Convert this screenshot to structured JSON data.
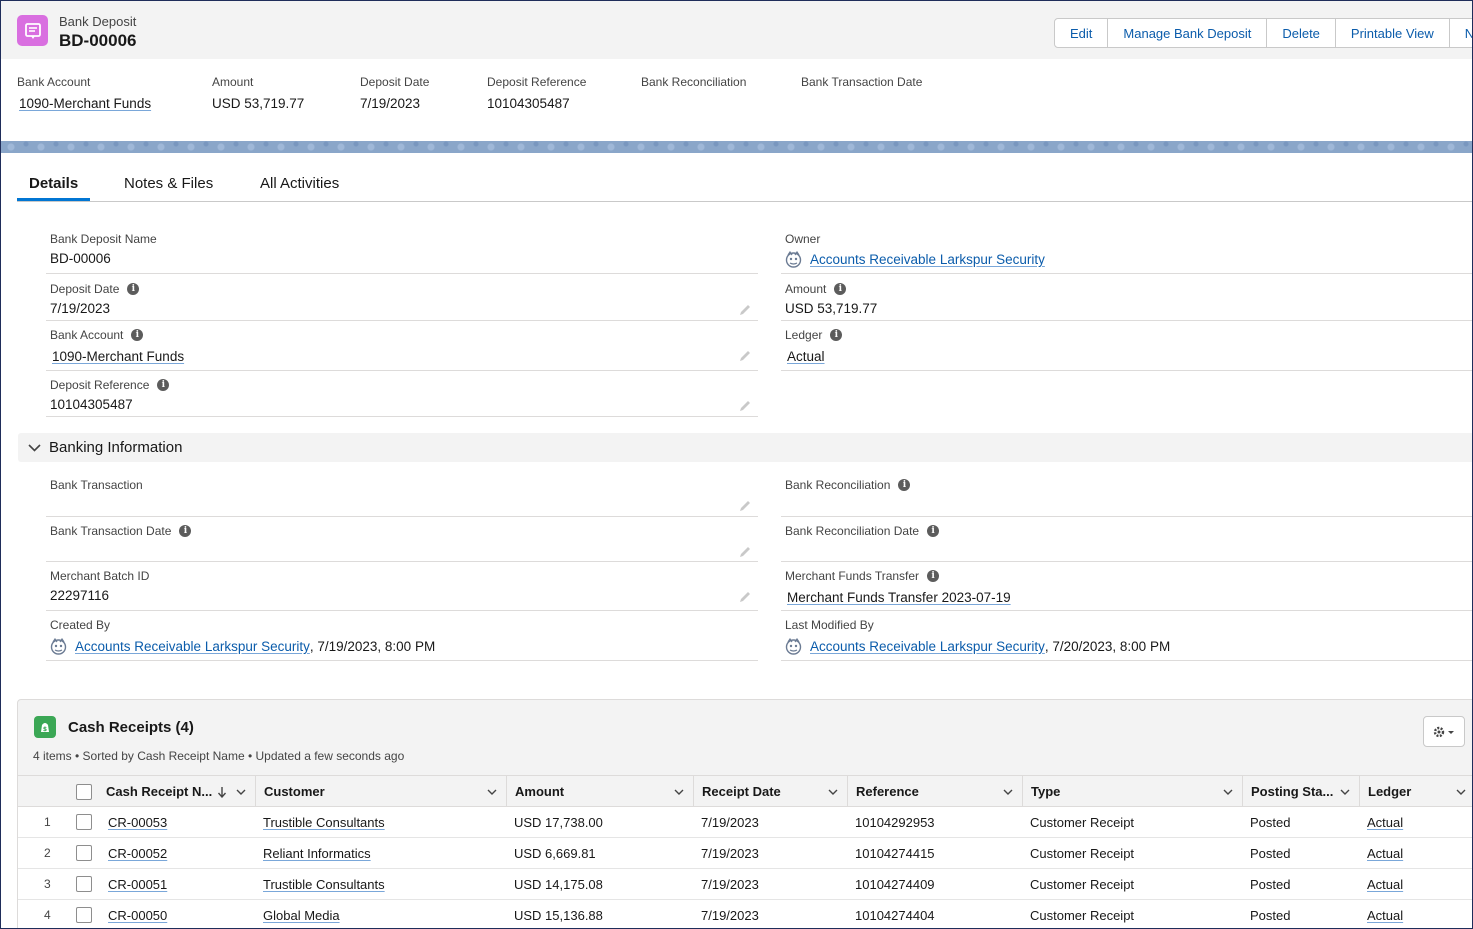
{
  "header": {
    "object_type": "Bank Deposit",
    "record_name": "BD-00006",
    "actions": [
      "Edit",
      "Manage Bank Deposit",
      "Delete",
      "Printable View",
      "New"
    ],
    "highlights": [
      {
        "label": "Bank Account",
        "value": "1090-Merchant Funds",
        "link": true
      },
      {
        "label": "Amount",
        "value": "USD 53,719.77",
        "link": false
      },
      {
        "label": "Deposit Date",
        "value": "7/19/2023",
        "link": false
      },
      {
        "label": "Deposit Reference",
        "value": "10104305487",
        "link": false
      },
      {
        "label": "Bank Reconciliation",
        "value": "",
        "link": false
      },
      {
        "label": "Bank Transaction Date",
        "value": "",
        "link": false
      }
    ]
  },
  "tabs": [
    "Details",
    "Notes & Files",
    "All Activities"
  ],
  "details": {
    "bank_deposit_name": {
      "label": "Bank Deposit Name",
      "value": "BD-00006"
    },
    "owner": {
      "label": "Owner",
      "value": "Accounts Receivable Larkspur Security"
    },
    "deposit_date": {
      "label": "Deposit Date",
      "value": "7/19/2023"
    },
    "amount": {
      "label": "Amount",
      "value": "USD 53,719.77"
    },
    "bank_account": {
      "label": "Bank Account",
      "value": "1090-Merchant Funds"
    },
    "ledger": {
      "label": "Ledger",
      "value": "Actual"
    },
    "deposit_reference": {
      "label": "Deposit Reference",
      "value": "10104305487"
    }
  },
  "banking": {
    "title": "Banking Information",
    "bank_transaction": {
      "label": "Bank Transaction",
      "value": ""
    },
    "bank_reconciliation": {
      "label": "Bank Reconciliation",
      "value": ""
    },
    "bank_transaction_date": {
      "label": "Bank Transaction Date",
      "value": ""
    },
    "bank_reconciliation_date": {
      "label": "Bank Reconciliation Date",
      "value": ""
    },
    "merchant_batch_id": {
      "label": "Merchant Batch ID",
      "value": "22297116"
    },
    "merchant_funds_transfer": {
      "label": "Merchant Funds Transfer",
      "value": "Merchant Funds Transfer 2023-07-19"
    },
    "created_by": {
      "label": "Created By",
      "user": "Accounts Receivable Larkspur Security",
      "date": ", 7/19/2023, 8:00 PM"
    },
    "last_modified_by": {
      "label": "Last Modified By",
      "user": "Accounts Receivable Larkspur Security",
      "date": ", 7/20/2023, 8:00 PM"
    }
  },
  "related": {
    "title": "Cash Receipts (4)",
    "subtitle": "4 items • Sorted by Cash Receipt Name • Updated a few seconds ago",
    "columns": [
      "Cash Receipt N...",
      "Customer",
      "Amount",
      "Receipt Date",
      "Reference",
      "Type",
      "Posting Sta...",
      "Ledger"
    ],
    "rows": [
      {
        "num": "1",
        "name": "CR-00053",
        "customer": "Trustible Consultants",
        "amount": "USD 17,738.00",
        "date": "7/19/2023",
        "reference": "10104292953",
        "type": "Customer Receipt",
        "status": "Posted",
        "ledger": "Actual"
      },
      {
        "num": "2",
        "name": "CR-00052",
        "customer": "Reliant Informatics",
        "amount": "USD 6,669.81",
        "date": "7/19/2023",
        "reference": "10104274415",
        "type": "Customer Receipt",
        "status": "Posted",
        "ledger": "Actual"
      },
      {
        "num": "3",
        "name": "CR-00051",
        "customer": "Trustible Consultants",
        "amount": "USD 14,175.08",
        "date": "7/19/2023",
        "reference": "10104274409",
        "type": "Customer Receipt",
        "status": "Posted",
        "ledger": "Actual"
      },
      {
        "num": "4",
        "name": "CR-00050",
        "customer": "Global Media",
        "amount": "USD 15,136.88",
        "date": "7/19/2023",
        "reference": "10104274404",
        "type": "Customer Receipt",
        "status": "Posted",
        "ledger": "Actual"
      }
    ]
  },
  "colors": {
    "brand_link": "#0b5cab",
    "accent": "#0176d3",
    "object_icon": "#d96fe0",
    "related_icon": "#3ba755"
  }
}
